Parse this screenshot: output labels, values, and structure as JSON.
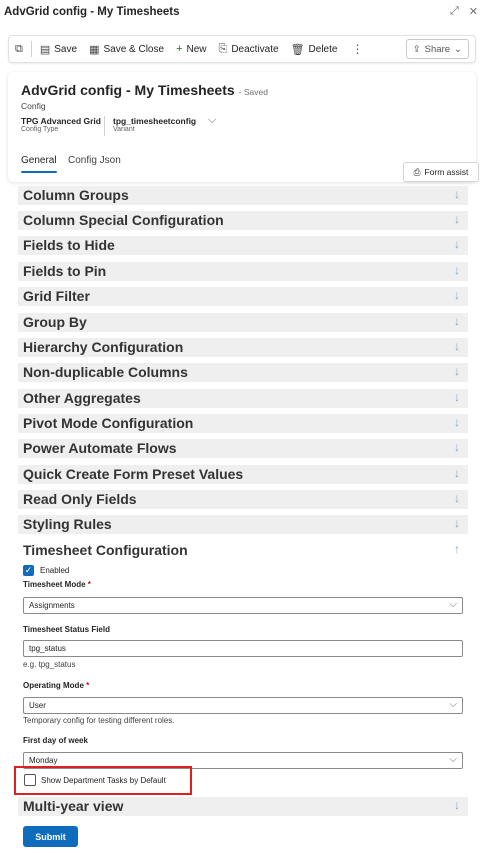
{
  "window": {
    "title": "AdvGrid config - My Timesheets",
    "icons": [
      "expand-icon",
      "close-icon"
    ]
  },
  "toolbar": {
    "save_label": "Save",
    "save_close_label": "Save & Close",
    "new_label": "New",
    "deactivate_label": "Deactivate",
    "delete_label": "Delete",
    "share_label": "Share"
  },
  "header": {
    "title": "AdvGrid config - My Timesheets",
    "status": "- Saved",
    "entity": "Config",
    "config_type_value": "TPG Advanced Grid",
    "config_type_label": "Config Type",
    "variant_value": "tpg_timesheetconfig",
    "variant_label": "Variant",
    "tabs": [
      {
        "label": "General",
        "active": true
      },
      {
        "label": "Config Json",
        "active": false
      }
    ],
    "form_assist_label": "Form assist"
  },
  "sections": [
    {
      "label": "Column Groups",
      "expanded": false
    },
    {
      "label": "Column Special Configuration",
      "expanded": false
    },
    {
      "label": "Fields to Hide",
      "expanded": false
    },
    {
      "label": "Fields to Pin",
      "expanded": false
    },
    {
      "label": "Grid Filter",
      "expanded": false
    },
    {
      "label": "Group By",
      "expanded": false
    },
    {
      "label": "Hierarchy Configuration",
      "expanded": false
    },
    {
      "label": "Non-duplicable Columns",
      "expanded": false
    },
    {
      "label": "Other Aggregates",
      "expanded": false
    },
    {
      "label": "Pivot Mode Configuration",
      "expanded": false
    },
    {
      "label": "Power Automate Flows",
      "expanded": false
    },
    {
      "label": "Quick Create Form Preset Values",
      "expanded": false
    },
    {
      "label": "Read Only Fields",
      "expanded": false
    },
    {
      "label": "Styling Rules",
      "expanded": false
    }
  ],
  "timesheet": {
    "title": "Timesheet Configuration",
    "expanded": true,
    "enabled_label": "Enabled",
    "enabled_checked": true,
    "mode_label": "Timesheet Mode",
    "mode_required": "*",
    "mode_value": "Assignments",
    "status_field_label": "Timesheet Status Field",
    "status_field_value": "tpg_status",
    "status_field_hint": "e.g. tpg_status",
    "operating_mode_label": "Operating Mode",
    "operating_mode_required": "*",
    "operating_mode_value": "User",
    "operating_mode_hint": "Temporary config for testing different roles.",
    "first_day_label": "First day of week",
    "first_day_value": "Monday",
    "show_dept_label": "Show Department Tasks by Default",
    "show_dept_checked": false
  },
  "multi_year": {
    "label": "Multi-year view",
    "expanded": false
  },
  "submit_label": "Submit",
  "colors": {
    "accent": "#0f6cbd",
    "highlight": "#e02020"
  }
}
